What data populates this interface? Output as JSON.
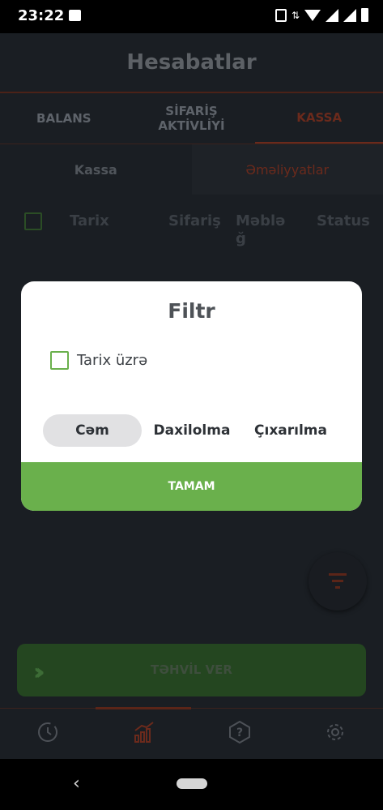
{
  "status_bar": {
    "time": "23:22",
    "network": "4"
  },
  "app": {
    "title": "Hesabatlar",
    "tabs": [
      {
        "label": "BALANS"
      },
      {
        "label": "SİFARİŞ AKTİVLİYİ"
      },
      {
        "label": "KASSA"
      }
    ],
    "subtabs": [
      {
        "label": "Kassa"
      },
      {
        "label": "Əməliyyatlar"
      }
    ],
    "table_headers": [
      {
        "label": "Tarix"
      },
      {
        "label": "Sifariş"
      },
      {
        "label": "Məbləğ"
      },
      {
        "label": "Status"
      }
    ],
    "filter_fab_icon": "filter-icon",
    "deliver_label": "TƏHVİL VER",
    "bottom_nav": [
      {
        "icon": "history-icon"
      },
      {
        "icon": "chart-icon"
      },
      {
        "icon": "help-icon"
      },
      {
        "icon": "settings-icon"
      }
    ]
  },
  "dialog": {
    "title": "Filtr",
    "checkbox_label": "Tarix üzrə",
    "segments": [
      {
        "label": "Cəm"
      },
      {
        "label": "Daxilolma"
      },
      {
        "label": "Çıxarılma"
      }
    ],
    "selected_segment": "Cəm",
    "ok_label": "TAMAM"
  },
  "colors": {
    "accent_green": "#6ab04c",
    "accent_orange_dim": "#6b2a1c",
    "background": "#1a1e23"
  }
}
